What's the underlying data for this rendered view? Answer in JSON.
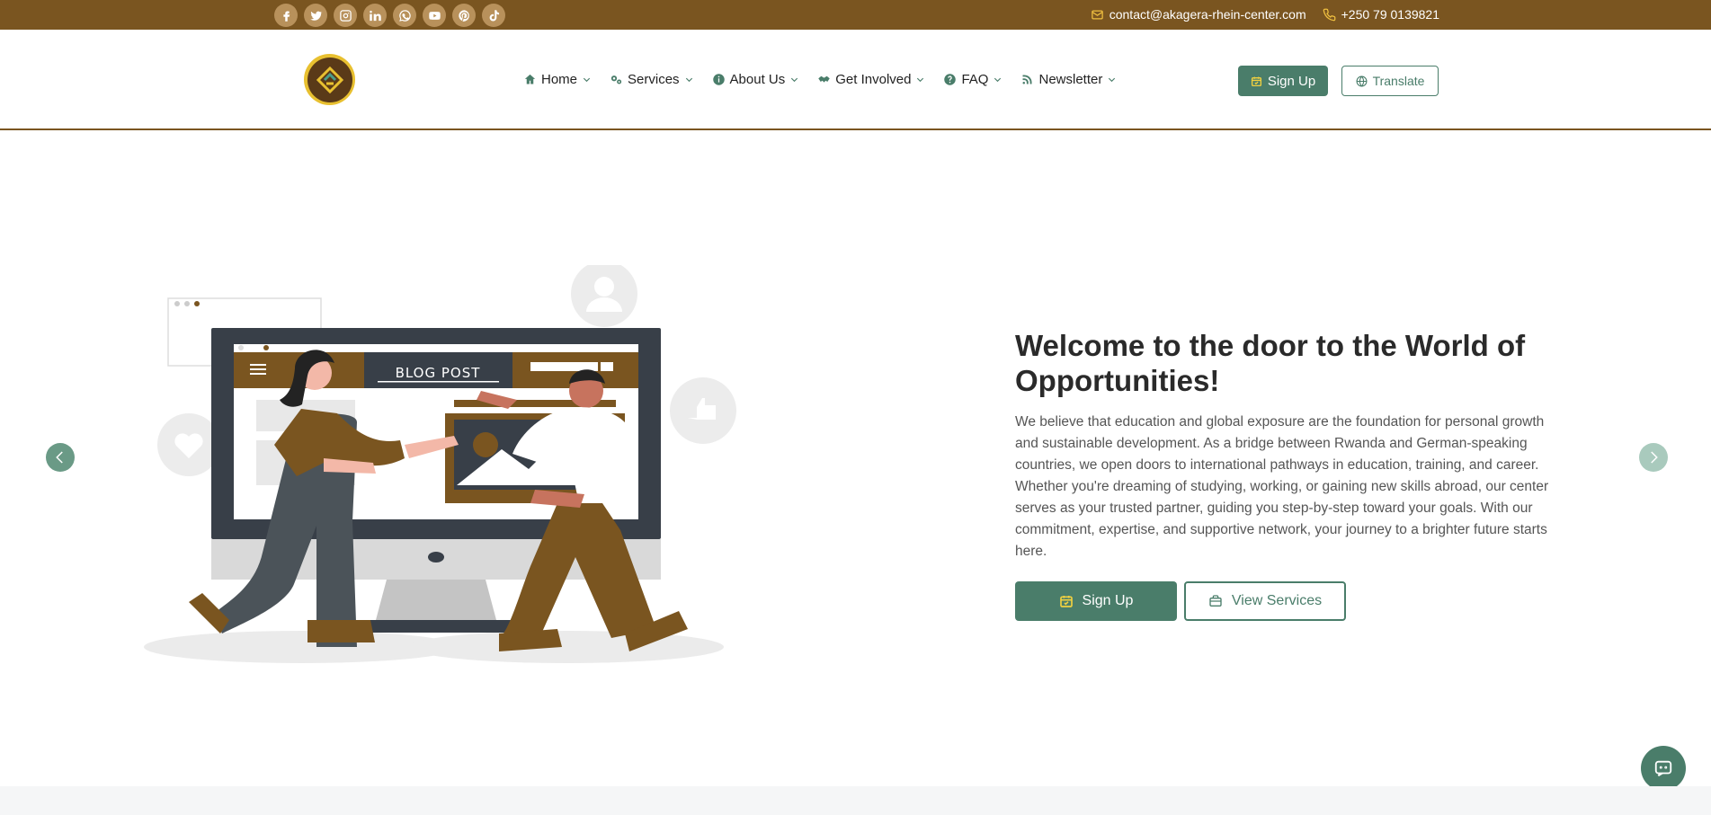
{
  "topbar": {
    "socials": [
      "facebook-icon",
      "twitter-icon",
      "instagram-icon",
      "linkedin-icon",
      "whatsapp-icon",
      "youtube-icon",
      "pinterest-icon",
      "tiktok-icon"
    ],
    "email": "contact@akagera-rhein-center.com",
    "phone": "+250 79 0139821"
  },
  "nav": {
    "items": [
      {
        "label": "Home",
        "icon": "home-icon"
      },
      {
        "label": "Services",
        "icon": "gears-icon"
      },
      {
        "label": "About Us",
        "icon": "info-icon"
      },
      {
        "label": "Get Involved",
        "icon": "handshake-icon"
      },
      {
        "label": "FAQ",
        "icon": "question-icon"
      },
      {
        "label": "Newsletter",
        "icon": "newspaper-icon"
      }
    ],
    "signup_label": "Sign Up",
    "translate_label": "Translate"
  },
  "hero": {
    "illustration_title": "BLOG POST",
    "title": "Welcome to the door to the World of Opportunities!",
    "text": "We believe that education and global exposure are the foundation for personal growth and sustainable development. As a bridge between Rwanda and German-speaking countries, we open doors to international pathways in education, training, and career. Whether you're dreaming of studying, working, or gaining new skills abroad, our center serves as your trusted partner, guiding you step-by-step toward your goals. With our commitment, expertise, and supportive network, your journey to a brighter future starts here.",
    "signup_label": "Sign Up",
    "services_label": "View Services"
  },
  "colors": {
    "brown": "#7a5520",
    "green": "#4a7d6a",
    "gold": "#e8c030"
  }
}
